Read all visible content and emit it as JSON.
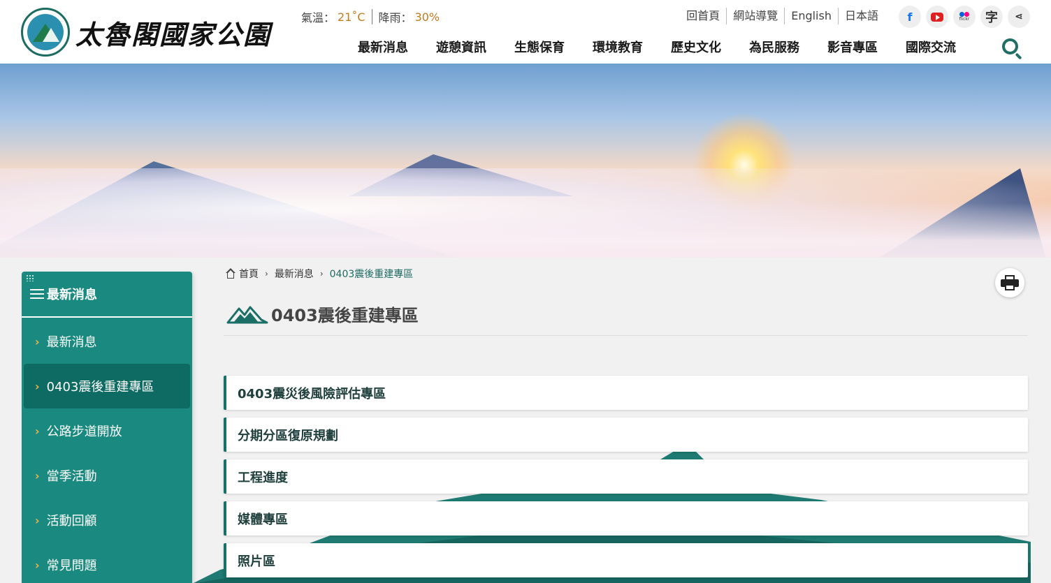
{
  "header": {
    "site_title": "太魯閣國家公園",
    "weather": {
      "temp_label": "氣溫：",
      "temp_value": "21˚C",
      "rain_label": "降雨：",
      "rain_value": "30%"
    },
    "top_links": [
      "回首頁",
      "網站導覽",
      "English",
      "日本語"
    ],
    "social_icons": [
      "facebook-icon",
      "youtube-icon",
      "flickr-icon",
      "font-size-icon",
      "share-icon"
    ],
    "flickr_text": "flickr",
    "font_size_glyph": "字",
    "share_glyph": "⋖",
    "nav": [
      "最新消息",
      "遊憩資訊",
      "生態保育",
      "環境教育",
      "歷史文化",
      "為民服務",
      "影音專區",
      "國際交流"
    ]
  },
  "sidebar": {
    "title": "最新消息",
    "items": [
      {
        "label": "最新消息",
        "active": false
      },
      {
        "label": "0403震後重建專區",
        "active": true
      },
      {
        "label": "公路步道開放",
        "active": false
      },
      {
        "label": "當季活動",
        "active": false
      },
      {
        "label": "活動回顧",
        "active": false
      },
      {
        "label": "常見問題",
        "active": false
      }
    ],
    "chevron": "›"
  },
  "breadcrumb": {
    "home": "首頁",
    "level1": "最新消息",
    "current": "0403震後重建專區",
    "separator": "›"
  },
  "page": {
    "title": "0403震後重建專區",
    "list": [
      "0403震災後風險評估專區",
      "分期分區復原規劃",
      "工程進度",
      "媒體專區",
      "照片區"
    ]
  },
  "colors": {
    "brand_green": "#1a8a80",
    "active_green": "#0e6b63",
    "accent_orange": "#c27a1f",
    "chevron_yellow": "#f1b545"
  }
}
